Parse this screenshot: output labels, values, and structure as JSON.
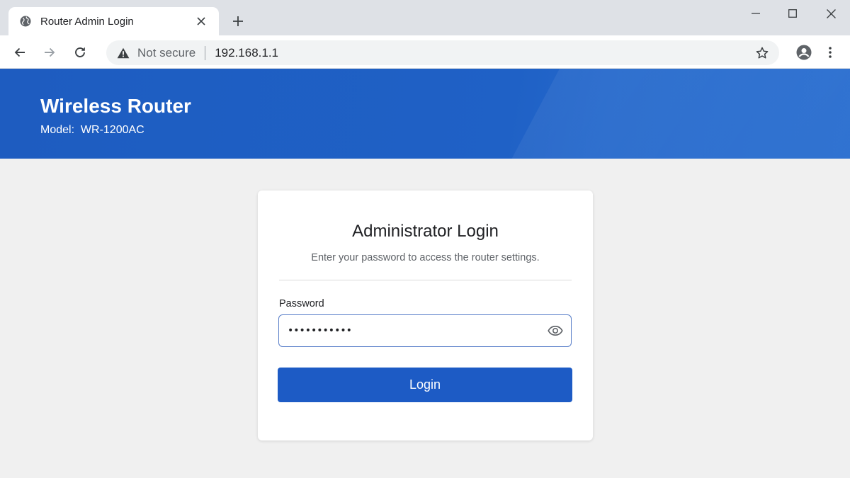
{
  "browser": {
    "tab_title": "Router Admin Login",
    "security_label": "Not secure",
    "url": "192.168.1.1",
    "icons": {
      "favicon": "globe-icon",
      "tab_close": "close-icon",
      "new_tab": "plus-icon",
      "back": "arrow-left-icon",
      "forward": "arrow-right-icon",
      "reload": "reload-icon",
      "security": "warning-icon",
      "bookmark": "star-icon",
      "profile": "account-icon",
      "menu": "more-vert-icon",
      "minimize": "minimize-icon",
      "maximize": "maximize-icon",
      "close_window": "close-icon"
    }
  },
  "header": {
    "title": "Wireless Router",
    "model": "Model:  WR-1200AC"
  },
  "login": {
    "title": "Administrator Login",
    "subtitle": "Enter your password to access the router settings.",
    "password_label": "Password",
    "password_value": "•••••••••••",
    "button_label": "Login"
  },
  "colors": {
    "banner": "#1f61c6",
    "button": "#1d5bc5",
    "page_bg": "#f0f0f0",
    "field_border": "#5a7fc9"
  }
}
